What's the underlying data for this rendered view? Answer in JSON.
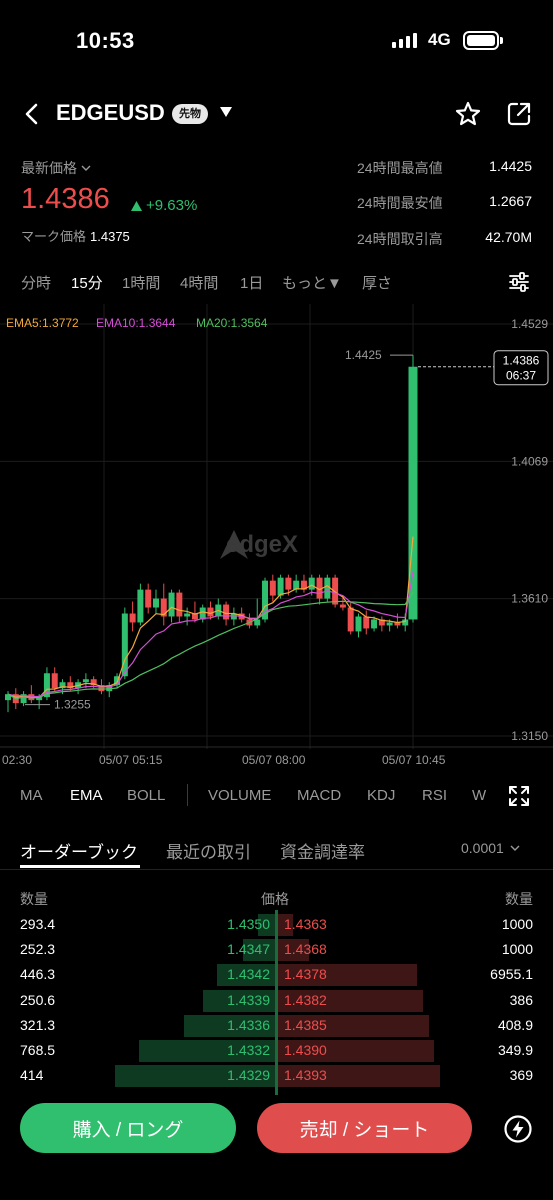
{
  "status": {
    "time": "10:53",
    "network": "4G"
  },
  "header": {
    "pair": "EDGEUSD",
    "badge": "先物"
  },
  "ticker": {
    "latest_label": "最新価格",
    "price": "1.4386",
    "change": "+9.63%",
    "mark_label": "マーク価格",
    "mark_value": "1.4375",
    "stats": [
      {
        "label": "24時間最高値",
        "value": "1.4425"
      },
      {
        "label": "24時間最安値",
        "value": "1.2667"
      },
      {
        "label": "24時間取引高",
        "value": "42.70M"
      }
    ]
  },
  "intervals": [
    "分時",
    "15分",
    "1時間",
    "4時間",
    "1日",
    "もっと▼",
    "厚さ"
  ],
  "active_interval": "15分",
  "chart_data": {
    "type": "candlestick",
    "legend": [
      {
        "label": "EMA5:1.3772",
        "color": "#f2a93b"
      },
      {
        "label": "EMA10:1.3644",
        "color": "#d64fd6"
      },
      {
        "label": "MA20:1.3564",
        "color": "#4fbf5f"
      }
    ],
    "y_ticks": [
      "1.4529",
      "1.4069",
      "1.3610",
      "1.3150"
    ],
    "x_ticks": [
      "02:30",
      "05/07 05:15",
      "05/07 08:00",
      "05/07 10:45"
    ],
    "ylim": [
      1.315,
      1.4529
    ],
    "high_marker": "1.4425",
    "low_marker": "1.3255",
    "last_price": "1.4386",
    "countdown": "06:37",
    "watermark": "edgeX",
    "candles": [
      [
        1.327,
        1.33,
        1.323,
        1.329
      ],
      [
        1.329,
        1.331,
        1.324,
        1.326
      ],
      [
        1.326,
        1.33,
        1.325,
        1.329
      ],
      [
        1.329,
        1.332,
        1.326,
        1.327
      ],
      [
        1.327,
        1.329,
        1.324,
        1.328
      ],
      [
        1.328,
        1.338,
        1.327,
        1.336
      ],
      [
        1.336,
        1.338,
        1.33,
        1.331
      ],
      [
        1.331,
        1.334,
        1.329,
        1.333
      ],
      [
        1.333,
        1.335,
        1.33,
        1.331
      ],
      [
        1.331,
        1.334,
        1.329,
        1.333
      ],
      [
        1.333,
        1.336,
        1.331,
        1.334
      ],
      [
        1.334,
        1.335,
        1.331,
        1.332
      ],
      [
        1.332,
        1.334,
        1.329,
        1.33
      ],
      [
        1.33,
        1.333,
        1.328,
        1.332
      ],
      [
        1.332,
        1.336,
        1.331,
        1.335
      ],
      [
        1.335,
        1.358,
        1.334,
        1.356
      ],
      [
        1.356,
        1.36,
        1.35,
        1.353
      ],
      [
        1.353,
        1.366,
        1.352,
        1.364
      ],
      [
        1.364,
        1.366,
        1.356,
        1.358
      ],
      [
        1.358,
        1.364,
        1.356,
        1.361
      ],
      [
        1.361,
        1.366,
        1.352,
        1.355
      ],
      [
        1.355,
        1.364,
        1.353,
        1.363
      ],
      [
        1.363,
        1.364,
        1.353,
        1.355
      ],
      [
        1.355,
        1.358,
        1.352,
        1.356
      ],
      [
        1.356,
        1.36,
        1.353,
        1.354
      ],
      [
        1.354,
        1.359,
        1.353,
        1.358
      ],
      [
        1.358,
        1.36,
        1.354,
        1.355
      ],
      [
        1.355,
        1.361,
        1.354,
        1.359
      ],
      [
        1.359,
        1.36,
        1.352,
        1.354
      ],
      [
        1.354,
        1.358,
        1.352,
        1.356
      ],
      [
        1.356,
        1.358,
        1.353,
        1.354
      ],
      [
        1.354,
        1.356,
        1.351,
        1.352
      ],
      [
        1.352,
        1.361,
        1.351,
        1.354
      ],
      [
        1.354,
        1.368,
        1.353,
        1.367
      ],
      [
        1.367,
        1.369,
        1.36,
        1.362
      ],
      [
        1.362,
        1.369,
        1.361,
        1.368
      ],
      [
        1.368,
        1.369,
        1.362,
        1.364
      ],
      [
        1.364,
        1.369,
        1.363,
        1.367
      ],
      [
        1.367,
        1.369,
        1.363,
        1.364
      ],
      [
        1.364,
        1.369,
        1.362,
        1.368
      ],
      [
        1.368,
        1.369,
        1.359,
        1.361
      ],
      [
        1.361,
        1.369,
        1.36,
        1.368
      ],
      [
        1.368,
        1.369,
        1.358,
        1.359
      ],
      [
        1.359,
        1.362,
        1.357,
        1.358
      ],
      [
        1.358,
        1.36,
        1.349,
        1.35
      ],
      [
        1.35,
        1.356,
        1.348,
        1.355
      ],
      [
        1.355,
        1.357,
        1.349,
        1.351
      ],
      [
        1.351,
        1.355,
        1.35,
        1.354
      ],
      [
        1.354,
        1.355,
        1.35,
        1.352
      ],
      [
        1.352,
        1.354,
        1.35,
        1.353
      ],
      [
        1.353,
        1.356,
        1.351,
        1.352
      ],
      [
        1.352,
        1.356,
        1.35,
        1.354
      ],
      [
        1.354,
        1.4425,
        1.353,
        1.4386
      ]
    ]
  },
  "indicator_tabs": [
    "MA",
    "EMA",
    "BOLL",
    "VOLUME",
    "MACD",
    "KDJ",
    "RSI",
    "W"
  ],
  "active_indicator": "EMA",
  "orderbook": {
    "tabs": [
      "オーダーブック",
      "最近の取引",
      "資金調達率"
    ],
    "precision": "0.0001",
    "headers": {
      "qty_left": "数量",
      "price": "価格",
      "qty_right": "数量"
    },
    "rows": [
      {
        "bid_qty": "293.4",
        "bid": "1.4350",
        "ask": "1.4363",
        "ask_qty": "1000"
      },
      {
        "bid_qty": "252.3",
        "bid": "1.4347",
        "ask": "1.4368",
        "ask_qty": "1000"
      },
      {
        "bid_qty": "446.3",
        "bid": "1.4342",
        "ask": "1.4378",
        "ask_qty": "6955.1"
      },
      {
        "bid_qty": "250.6",
        "bid": "1.4339",
        "ask": "1.4382",
        "ask_qty": "386"
      },
      {
        "bid_qty": "321.3",
        "bid": "1.4336",
        "ask": "1.4385",
        "ask_qty": "408.9"
      },
      {
        "bid_qty": "768.5",
        "bid": "1.4332",
        "ask": "1.4390",
        "ask_qty": "349.9"
      },
      {
        "bid_qty": "414",
        "bid": "1.4329",
        "ask": "1.4393",
        "ask_qty": "369"
      }
    ]
  },
  "actions": {
    "buy": "購入 / ロング",
    "sell": "売却 / ショート"
  },
  "colors": {
    "up": "#2fbf6f",
    "down": "#ee4d4d"
  }
}
